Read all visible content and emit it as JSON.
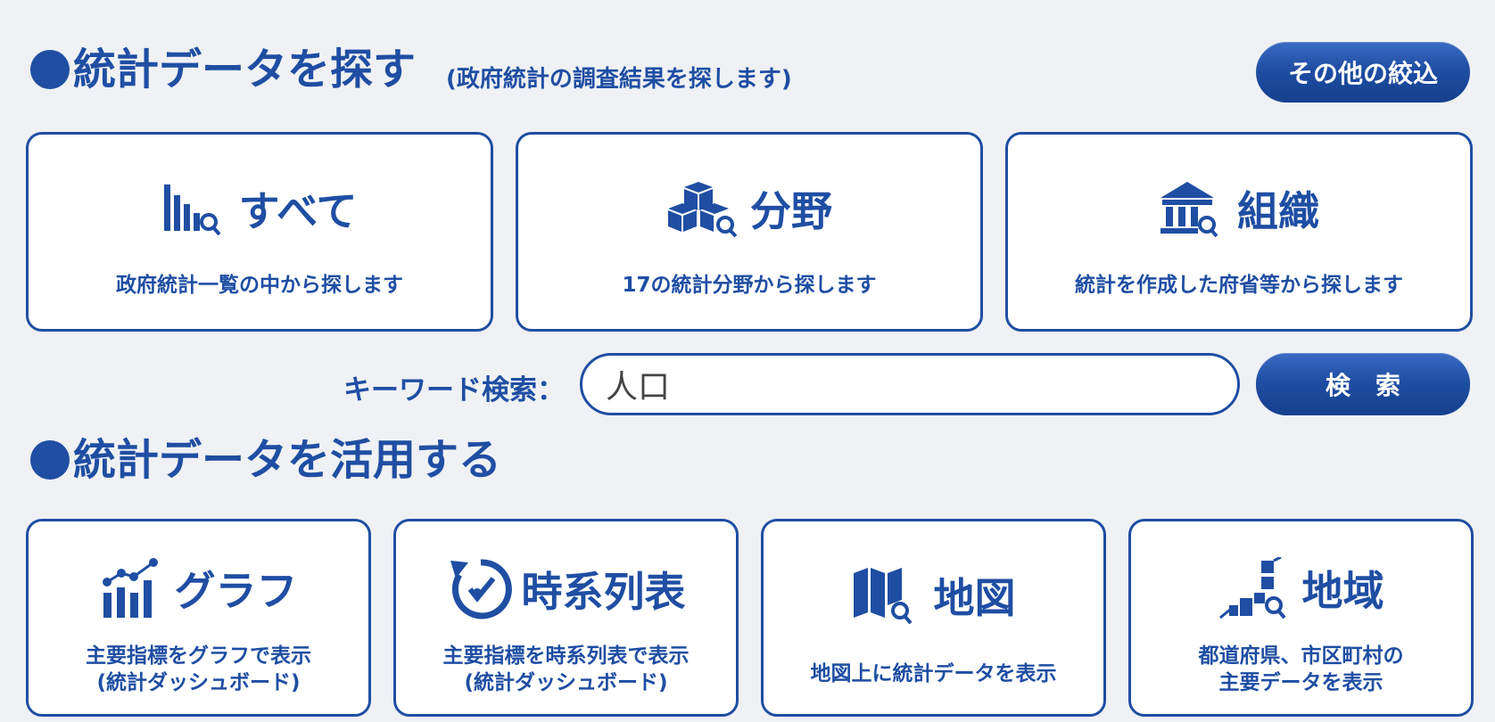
{
  "search_section": {
    "title": "統計データを探す",
    "subtitle": "(政府統計の調査結果を探します)",
    "filter_button": "その他の絞込",
    "cards": [
      {
        "label": "すべて",
        "desc": "政府統計一覧の中から探します",
        "icon": "bar-chart-search-icon"
      },
      {
        "label": "分野",
        "desc": "17の統計分野から探します",
        "icon": "cubes-search-icon"
      },
      {
        "label": "組織",
        "desc": "統計を作成した府省等から探します",
        "icon": "building-search-icon"
      }
    ],
    "keyword_label": "キーワード検索：",
    "keyword_value": "人口",
    "search_button": "検　索"
  },
  "use_section": {
    "title": "統計データを活用する",
    "cards": [
      {
        "label": "グラフ",
        "desc_line1": "主要指標をグラフで表示",
        "desc_line2": "(統計ダッシュボード)",
        "icon": "line-bar-chart-icon"
      },
      {
        "label": "時系列表",
        "desc_line1": "主要指標を時系列表で表示",
        "desc_line2": "(統計ダッシュボード)",
        "icon": "clock-icon"
      },
      {
        "label": "地図",
        "desc_line1": "地図上に統計データを表示",
        "desc_line2": "",
        "icon": "map-search-icon"
      },
      {
        "label": "地域",
        "desc_line1": "都道府県、市区町村の",
        "desc_line2": "主要データを表示",
        "icon": "region-blocks-search-icon"
      }
    ]
  },
  "colors": {
    "accent": "#1f4ea3",
    "background": "#eff1f4"
  }
}
